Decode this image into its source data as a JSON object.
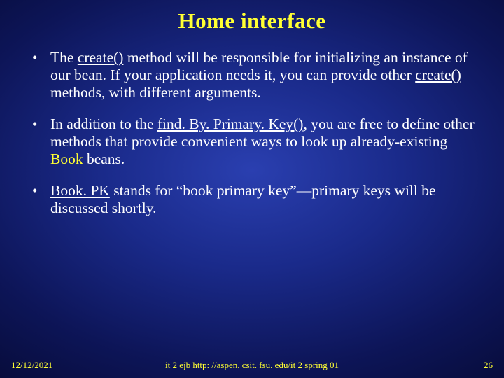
{
  "title": "Home interface",
  "bullets": [
    {
      "t1": "The ",
      "u1": "create()",
      "t2": " method will be responsible for initializing an instance of our bean. If your application needs it, you can provide other ",
      "u2": "create()",
      "t3": " methods, with different arguments."
    },
    {
      "t1": "In addition to the ",
      "u1": "find. By. Primary. Key()",
      "t2": ", you are free to define other methods that provide convenient ways to look up already-existing ",
      "y1": "Book",
      "t3": " beans."
    },
    {
      "u1": "Book. PK",
      "t1": " stands for “book primary key”—primary keys will be discussed shortly."
    }
  ],
  "footer": {
    "date": "12/12/2021",
    "middle": "it 2 ejb  http: //aspen. csit. fsu. edu/it 2 spring 01",
    "page": "26"
  }
}
